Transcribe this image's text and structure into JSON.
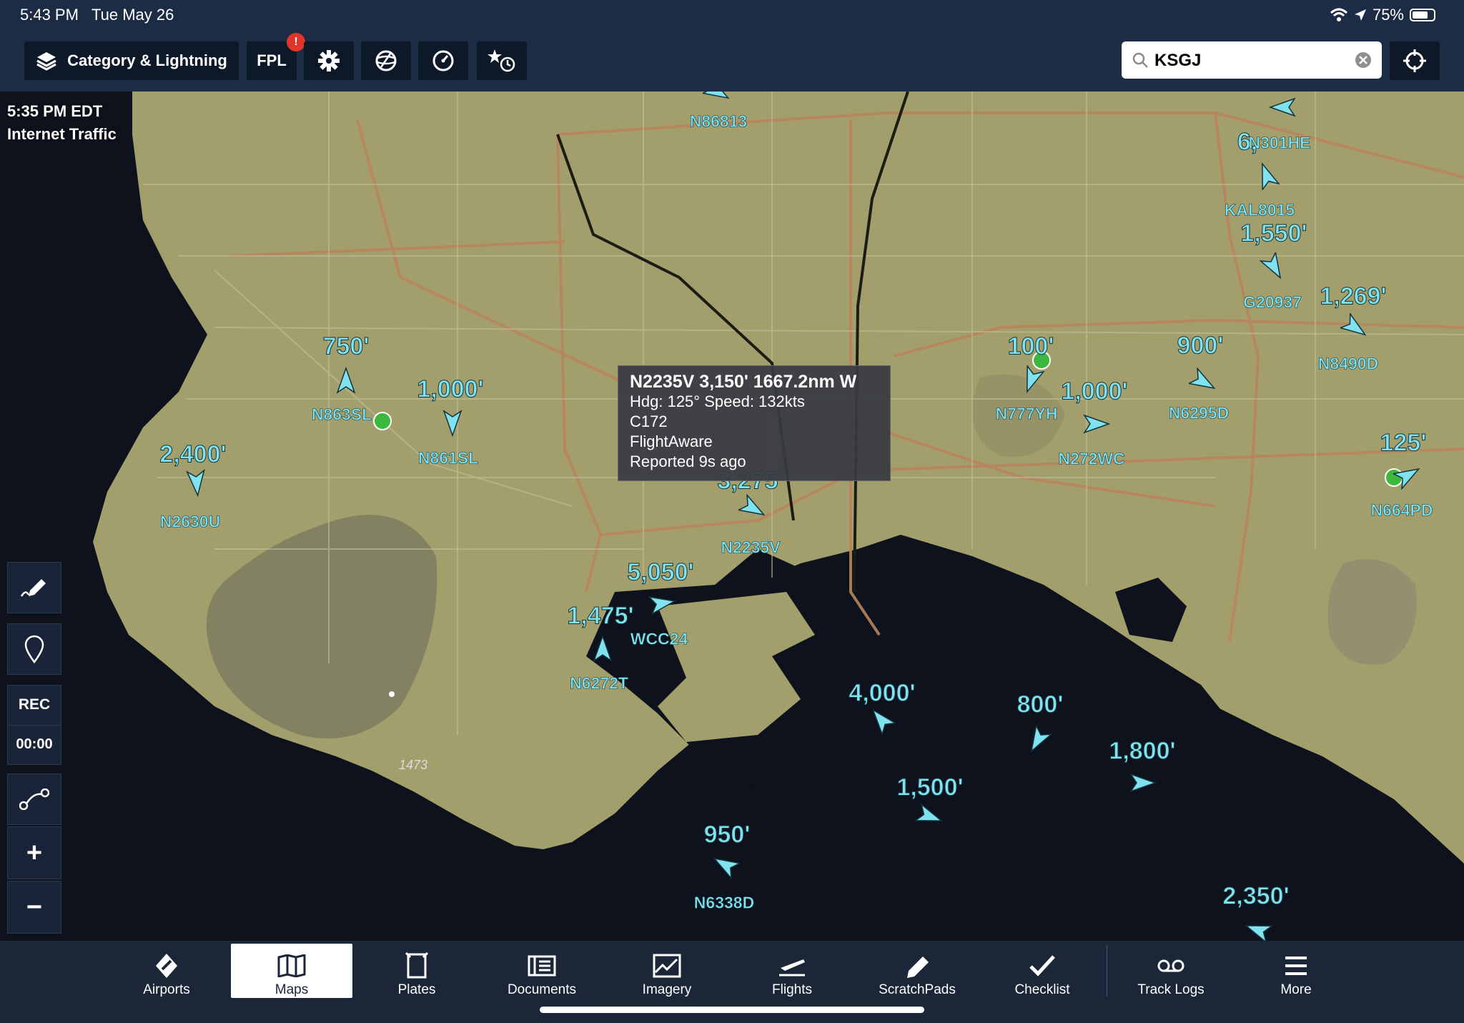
{
  "status_bar": {
    "time": "5:43 PM",
    "date": "Tue May 26",
    "battery": "75%",
    "battery_level": 0.75
  },
  "toolbar": {
    "layers_label": "Category & Lightning",
    "fpl_label": "FPL",
    "fpl_badge": "!",
    "icons": [
      "layers-icon",
      "gear-icon",
      "globe-icon",
      "gauge-icon",
      "star-clock-icon",
      "locate-icon"
    ]
  },
  "search": {
    "value": "KSGJ"
  },
  "map": {
    "time_label": "5:35 PM EDT",
    "source_label": "Internet Traffic",
    "elevation_label": "1473",
    "popup": {
      "title": "N2235V 3,150' 1667.2nm W",
      "line1": "Hdg: 125°  Speed: 132kts",
      "line2": "C172",
      "line3": "FlightAware",
      "line4": "Reported 9s ago"
    },
    "traffic": [
      {
        "callsign": "N86813",
        "altitude": ""
      },
      {
        "callsign": "N301HE",
        "altitude": "6,"
      },
      {
        "callsign": "KAL8015",
        "altitude": ""
      },
      {
        "callsign": "G20937",
        "altitude": "1,550'"
      },
      {
        "callsign": "N8490D",
        "altitude": "1,269'"
      },
      {
        "callsign": "N863SL",
        "altitude": "750'"
      },
      {
        "callsign": "N861SL",
        "altitude": "1,000'"
      },
      {
        "callsign": "N2630U",
        "altitude": "2,400'"
      },
      {
        "callsign": "N777YH",
        "altitude": "100'"
      },
      {
        "callsign": "N272WC",
        "altitude": "1,000'"
      },
      {
        "callsign": "N6295D",
        "altitude": "900'"
      },
      {
        "callsign": "N664PD",
        "altitude": "125'"
      },
      {
        "callsign": "N2235V",
        "altitude": "3,275'"
      },
      {
        "callsign": "WCC24",
        "altitude": "5,050'"
      },
      {
        "callsign": "N6272T",
        "altitude": "1,475'"
      },
      {
        "callsign": "",
        "altitude": "4,000'"
      },
      {
        "callsign": "",
        "altitude": "800'"
      },
      {
        "callsign": "",
        "altitude": "1,800'"
      },
      {
        "callsign": "",
        "altitude": "1,500'"
      },
      {
        "callsign": "N6338D",
        "altitude": "950'"
      },
      {
        "callsign": "",
        "altitude": "2,350'"
      }
    ]
  },
  "left_controls": {
    "rec_label": "REC",
    "timer": "00:00",
    "zoom_in": "+",
    "zoom_out": "−"
  },
  "tabs": [
    {
      "label": "Airports",
      "icon": "airport-icon"
    },
    {
      "label": "Maps",
      "icon": "map-icon",
      "active": true
    },
    {
      "label": "Plates",
      "icon": "plates-icon"
    },
    {
      "label": "Documents",
      "icon": "documents-icon"
    },
    {
      "label": "Imagery",
      "icon": "imagery-icon"
    },
    {
      "label": "Flights",
      "icon": "flights-icon"
    },
    {
      "label": "ScratchPads",
      "icon": "scratchpad-icon"
    },
    {
      "label": "Checklist",
      "icon": "checklist-icon"
    },
    {
      "label": "Track Logs",
      "icon": "track-logs-icon"
    },
    {
      "label": "More",
      "icon": "more-icon"
    }
  ],
  "colors": {
    "land": "#a29f6c",
    "water": "#0d121c",
    "traffic": "#7fe2ee",
    "bar": "#1c2c45",
    "accent_red": "#e0352b"
  }
}
